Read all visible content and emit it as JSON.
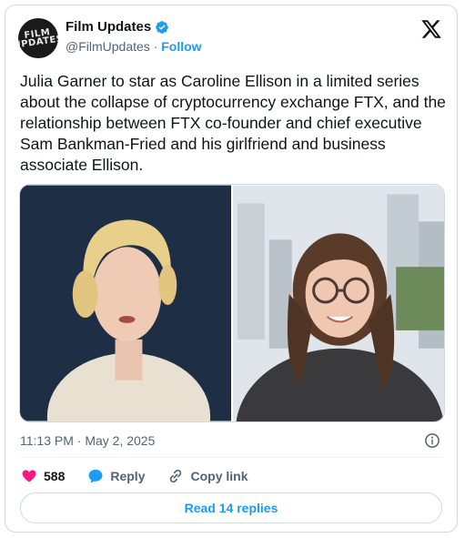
{
  "author": {
    "name": "Film Updates",
    "handle": "@FilmUpdates",
    "separator": "·",
    "follow_label": "Follow",
    "avatar_text": "FILM UPDATES"
  },
  "tweet": {
    "text": "Julia Garner to star as Caroline Ellison in a limited series about the collapse of cryptocurrency exchange FTX, and the relationship between FTX co-founder and chief executive Sam Bankman-Fried and his girlfriend and business associate Ellison.",
    "timestamp": "11:13 PM · May 2, 2025"
  },
  "actions": {
    "like_count": "588",
    "reply_label": "Reply",
    "copy_label": "Copy link"
  },
  "read_replies_label": "Read 14 replies",
  "colors": {
    "accent": "#1d9bf0",
    "like": "#f91880",
    "muted": "#536471",
    "border": "#cfd9de"
  }
}
